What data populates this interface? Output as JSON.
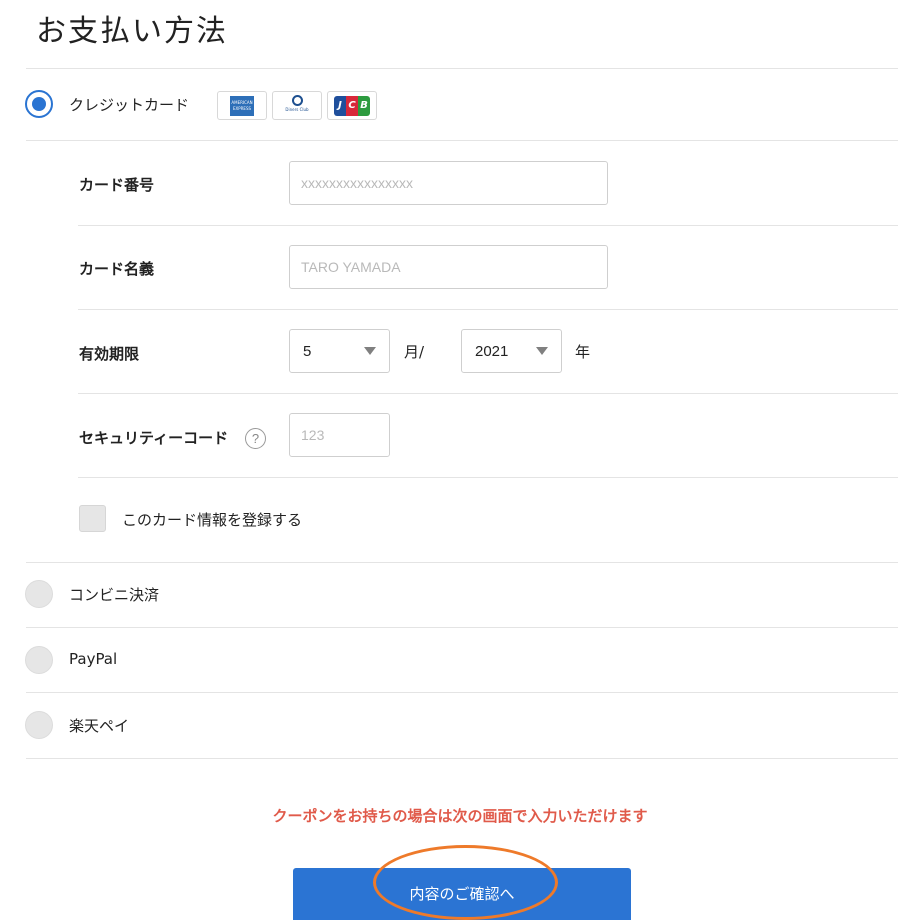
{
  "page": {
    "title": "お支払い方法"
  },
  "payment_methods": {
    "credit_card": {
      "label": "クレジットカード",
      "selected": true,
      "card_brands": [
        {
          "name": "American Express",
          "icon": "amex-logo-icon"
        },
        {
          "name": "Diners Club",
          "icon": "diners-logo-icon"
        },
        {
          "name": "JCB",
          "icon": "jcb-logo-icon",
          "text": "JCB"
        }
      ]
    },
    "convenience_store": {
      "label": "コンビニ決済",
      "selected": false
    },
    "paypal": {
      "label": "PayPal",
      "selected": false
    },
    "rakuten_pay": {
      "label": "楽天ペイ",
      "selected": false
    }
  },
  "card_form": {
    "card_number": {
      "label": "カード番号",
      "value": "",
      "placeholder": "xxxxxxxxxxxxxxxx"
    },
    "card_holder": {
      "label": "カード名義",
      "value": "",
      "placeholder": "TARO YAMADA"
    },
    "expiry": {
      "label": "有効期限",
      "month": "5",
      "month_unit": "月/",
      "year": "2021",
      "year_unit": "年"
    },
    "security_code": {
      "label": "セキュリティーコード",
      "value": "",
      "placeholder": "123",
      "help_icon": "question-circle-icon",
      "help_text": "?"
    },
    "save_card": {
      "label": "このカード情報を登録する",
      "checked": false
    }
  },
  "coupon_note": "クーポンをお持ちの場合は次の画面で入力いただけます",
  "confirm_button": {
    "label": "内容のご確認へ"
  },
  "colors": {
    "accent": "#2b74d3",
    "note": "#e05a4a",
    "annotation": "#ee7a2a"
  }
}
